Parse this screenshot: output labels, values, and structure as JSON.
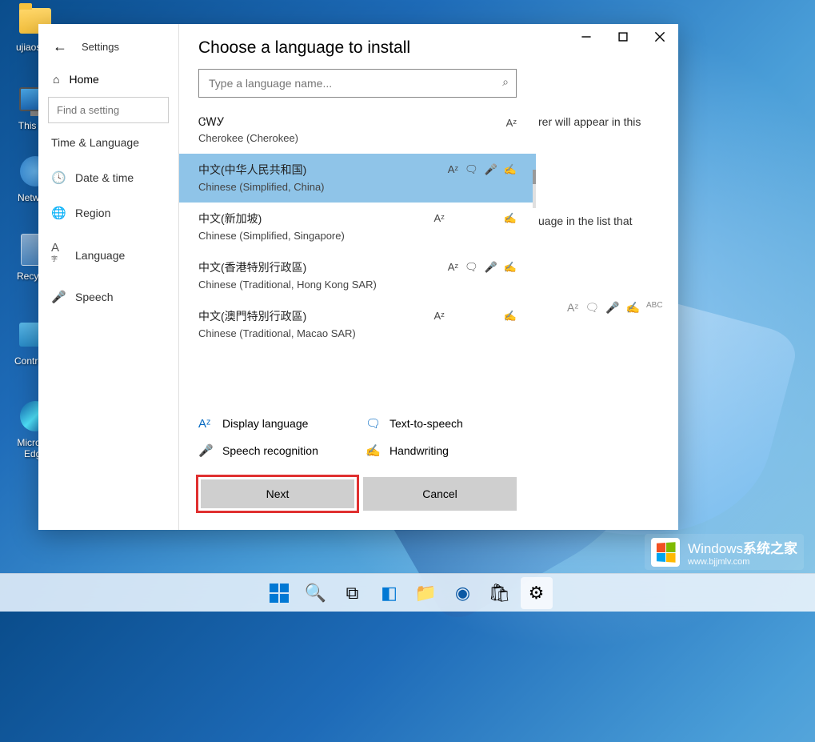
{
  "desktop": {
    "icons": [
      {
        "label": "ujiaosh...",
        "type": "folder"
      },
      {
        "label": "This P...",
        "type": "pc"
      },
      {
        "label": "Netwo...",
        "type": "network"
      },
      {
        "label": "Recycl...",
        "type": "bin"
      },
      {
        "label": "Control ...",
        "type": "cpl"
      },
      {
        "label": "Micros... Edge",
        "type": "edge"
      }
    ]
  },
  "settings": {
    "back_label": "Settings",
    "home": "Home",
    "find_placeholder": "Find a setting",
    "section": "Time & Language",
    "nav": [
      {
        "icon": "clock",
        "label": "Date & time"
      },
      {
        "icon": "globe",
        "label": "Region"
      },
      {
        "icon": "lang",
        "label": "Language"
      },
      {
        "icon": "mic",
        "label": "Speech"
      }
    ],
    "content": {
      "partial1": "rer will appear in this",
      "partial2": "uage in the list that"
    }
  },
  "dialog": {
    "title": "Choose a language to install",
    "search_placeholder": "Type a language name...",
    "languages": [
      {
        "native": "ᏣᎳᎩ",
        "english": "Cherokee (Cherokee)",
        "features": [
          "display"
        ]
      },
      {
        "native": "中文(中华人民共和国)",
        "english": "Chinese (Simplified, China)",
        "features": [
          "display",
          "tts",
          "speech",
          "hand"
        ],
        "selected": true
      },
      {
        "native": "中文(新加坡)",
        "english": "Chinese (Simplified, Singapore)",
        "features": [
          "display",
          "hand"
        ]
      },
      {
        "native": "中文(香港特別行政區)",
        "english": "Chinese (Traditional, Hong Kong SAR)",
        "features": [
          "display",
          "tts",
          "speech",
          "hand"
        ]
      },
      {
        "native": "中文(澳門特別行政區)",
        "english": "Chinese (Traditional, Macao SAR)",
        "features": [
          "display",
          "hand"
        ]
      }
    ],
    "legend": {
      "display": "Display language",
      "tts": "Text-to-speech",
      "speech": "Speech recognition",
      "hand": "Handwriting"
    },
    "next": "Next",
    "cancel": "Cancel"
  },
  "watermark": {
    "title_a": "Windows",
    "title_b": "系统之家",
    "url": "www.bjjmlv.com"
  }
}
